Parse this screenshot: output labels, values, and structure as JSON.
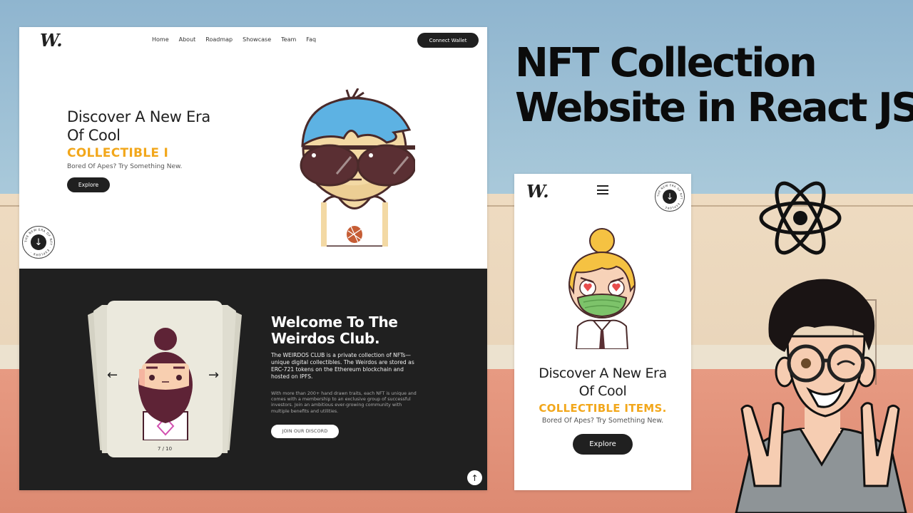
{
  "headline": {
    "line1": "NFT Collection",
    "line2": "Website in React JS"
  },
  "desktop": {
    "logo": "W.",
    "nav": [
      "Home",
      "About",
      "Roadmap",
      "Showcase",
      "Team",
      "Faq"
    ],
    "connect_wallet": "Connect Wallet",
    "hero": {
      "title": "Discover A New Era Of Cool",
      "typed": "COLLECTIBLE I",
      "subtitle": "Bored Of Apes? Try Something New.",
      "explore": "Explore"
    },
    "badge": {
      "ring_text": "THE NEW ERA OF NFT · EXPLORE ·",
      "icon": "arrow-down"
    },
    "about": {
      "title": "Welcome To The Weirdos Club.",
      "paragraph1": "The WEIRDOS CLUB is a private collection of NFTs—unique digital collectibles. The Weirdos are stored as ERC-721 tokens on the Ethereum blockchain and hosted on IPFS.",
      "paragraph2": "With more than 200+ hand drawn traits, each NFT is unique and comes with a membership to an exclusive group of successful investors. Join an ambitious ever-growing community with multiple benefits and utilities.",
      "discord": "JOIN OUR DISCORD",
      "carousel": {
        "prev": "←",
        "next": "→",
        "counter": "7 / 10",
        "current": 7,
        "total": 10
      },
      "scroll_top": "↑"
    }
  },
  "mobile": {
    "logo": "W.",
    "menu_icon": "hamburger",
    "badge": {
      "ring_text": "THE NEW ERA OF NFT · EXPLORE ·",
      "icon": "arrow-down"
    },
    "hero": {
      "title_line1": "Discover A New Era",
      "title_line2": "Of Cool",
      "typed": "COLLECTIBLE ITEMS.",
      "subtitle": "Bored Of Apes? Try Something New.",
      "explore": "Explore"
    }
  },
  "colors": {
    "accent_yellow": "#f2a71b",
    "dark": "#202020",
    "white": "#ffffff",
    "card": "#ebe9dd"
  }
}
